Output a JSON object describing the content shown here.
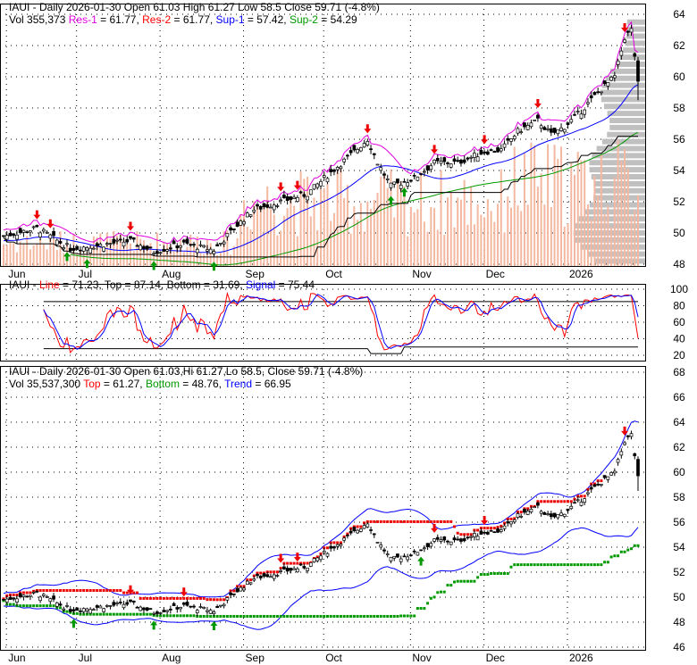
{
  "ticker": "IAUI",
  "panel1": {
    "line1": {
      "prefix": "IAUI - Daily 2026-01-30 Open 61.03  High 61.27  Low 58.5  Close 59.71 (-4.8%)"
    },
    "vol": "Vol 355,373",
    "res1_label": "Res-1",
    "res1": " = 61.77, ",
    "res2_label": "Res-2",
    "res2": " = 61.77, ",
    "sup1_label": "Sup-1",
    "sup1": " = 57.42, ",
    "sup2_label": "Sup-2",
    "sup2": " = 54.29"
  },
  "panel2": {
    "prefix": "IAUI - ",
    "line_label": "Line",
    "line": " = 71.23, Top = 87.14, Bottom = 31.69, ",
    "signal_label": "Signal",
    "signal": " = 75.44"
  },
  "panel3": {
    "line1": "IAUI - Daily 2026-01-30 Open 61.03,Hi 61.27,Lo 58.5, Close 59.71 (-4.8%)",
    "vol": "Vol 35,537,300 ",
    "top_label": "Top",
    "top": " = 61.27, ",
    "bottom_label": "Bottom",
    "bottom": " = 48.76, ",
    "trend_label": "Trend",
    "trend": " = 66.95"
  },
  "colors": {
    "up": "#000000",
    "res1": "#e000e0",
    "res2": "#ff0000",
    "sup1": "#0000ff",
    "sup2": "#009900",
    "volume": "#f4b8a0",
    "vbp": "#c0c0c0"
  },
  "chart_data": [
    {
      "type": "candlestick",
      "title": "IAUI - Daily",
      "ylim": [
        48,
        64
      ],
      "yticks": [
        48,
        50,
        52,
        54,
        56,
        58,
        60,
        62,
        64
      ],
      "xticks": [
        "Jun",
        "Jul",
        "Aug",
        "Sep",
        "Oct",
        "Nov",
        "Dec",
        "2026"
      ],
      "last": {
        "date": "2026-01-30",
        "open": 61.03,
        "high": 61.27,
        "low": 58.5,
        "close": 59.71,
        "change_pct": -4.8
      },
      "close_keypoints": [
        [
          0,
          49.8
        ],
        [
          10,
          50.3
        ],
        [
          20,
          49.0
        ],
        [
          28,
          49.2
        ],
        [
          38,
          49.5
        ],
        [
          45,
          48.8
        ],
        [
          54,
          49.3
        ],
        [
          63,
          48.9
        ],
        [
          70,
          50.5
        ],
        [
          75,
          51.5
        ],
        [
          83,
          52.0
        ],
        [
          91,
          52.5
        ],
        [
          96,
          53.5
        ],
        [
          104,
          55
        ],
        [
          109,
          56
        ],
        [
          112,
          54.5
        ],
        [
          116,
          53
        ],
        [
          123,
          53.5
        ],
        [
          129,
          54.5
        ],
        [
          136,
          54.5
        ],
        [
          144,
          55.2
        ],
        [
          149,
          55.3
        ],
        [
          154,
          56.5
        ],
        [
          160,
          57.2
        ],
        [
          164,
          56.3
        ],
        [
          168,
          56.8
        ],
        [
          173,
          57.8
        ],
        [
          178,
          59
        ],
        [
          183,
          60
        ],
        [
          186,
          62.5
        ],
        [
          188,
          63
        ],
        [
          190,
          59.71
        ]
      ]
    },
    {
      "type": "line",
      "title": "Stochastic",
      "ylim": [
        20,
        100
      ],
      "yticks": [
        20,
        40,
        60,
        80,
        100
      ],
      "line": 71.23,
      "top": 87.14,
      "bottom": 31.69,
      "signal": 75.44
    },
    {
      "type": "candlestick",
      "title": "IAUI - Daily bands",
      "ylim": [
        46,
        68
      ],
      "yticks": [
        46,
        48,
        50,
        52,
        54,
        56,
        58,
        60,
        62,
        64,
        66,
        68
      ],
      "xticks": [
        "Jun",
        "Jul",
        "Aug",
        "Sep",
        "Oct",
        "Nov",
        "Dec",
        "2026"
      ],
      "top": 61.27,
      "bottom": 48.76,
      "trend": 66.95
    }
  ]
}
